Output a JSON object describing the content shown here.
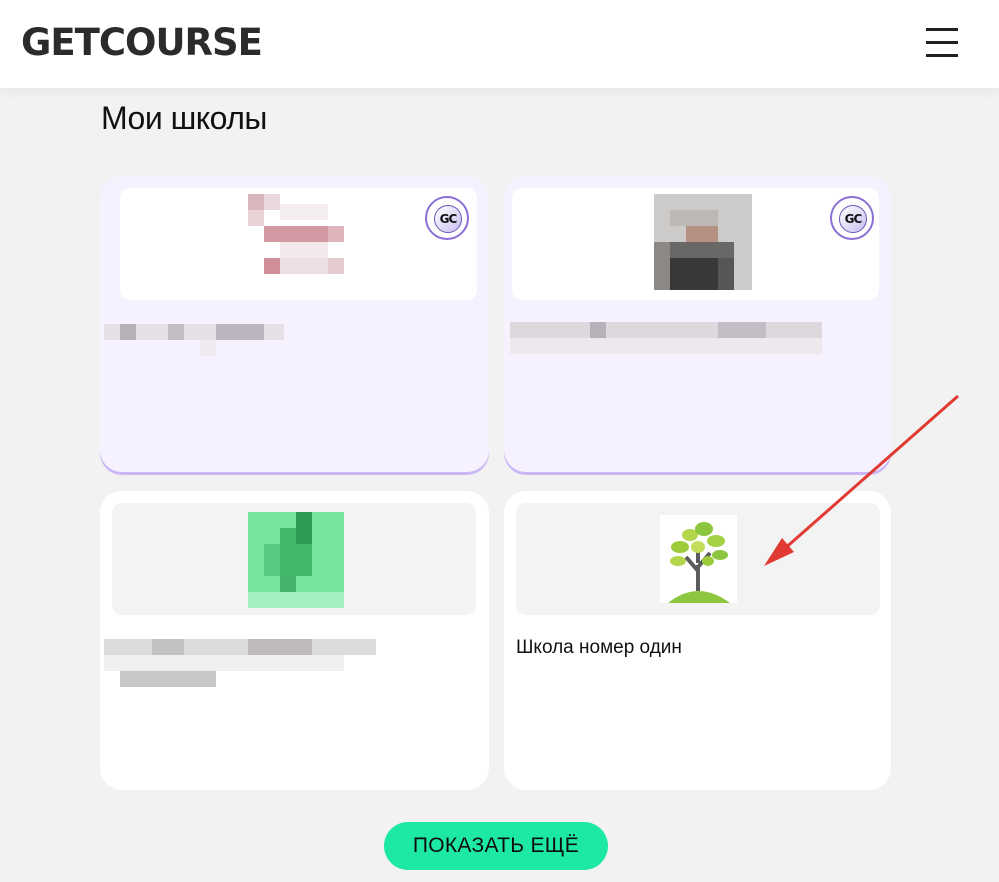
{
  "header": {
    "logo_text": "GETCOURSE",
    "menu_icon": "hamburger-menu-icon"
  },
  "main": {
    "title": "Мои школы",
    "schools": [
      {
        "name": "",
        "verified": true,
        "badge_text": "GC",
        "logo": "pixelated-image"
      },
      {
        "name": "",
        "verified": true,
        "badge_text": "GC",
        "logo": "pixelated-image"
      },
      {
        "name": "",
        "verified": false,
        "logo": "pixelated-image"
      },
      {
        "name": "Школа номер один",
        "verified": false,
        "logo": "tree-icon"
      }
    ],
    "show_more_label": "ПОКАЗАТЬ ЕЩЁ"
  },
  "annotation": {
    "arrow_color": "#e03a33"
  },
  "colors": {
    "accent": "#1de9a4",
    "verified_card_bg": "#f6f1ff",
    "page_bg": "#f2f2f2"
  }
}
